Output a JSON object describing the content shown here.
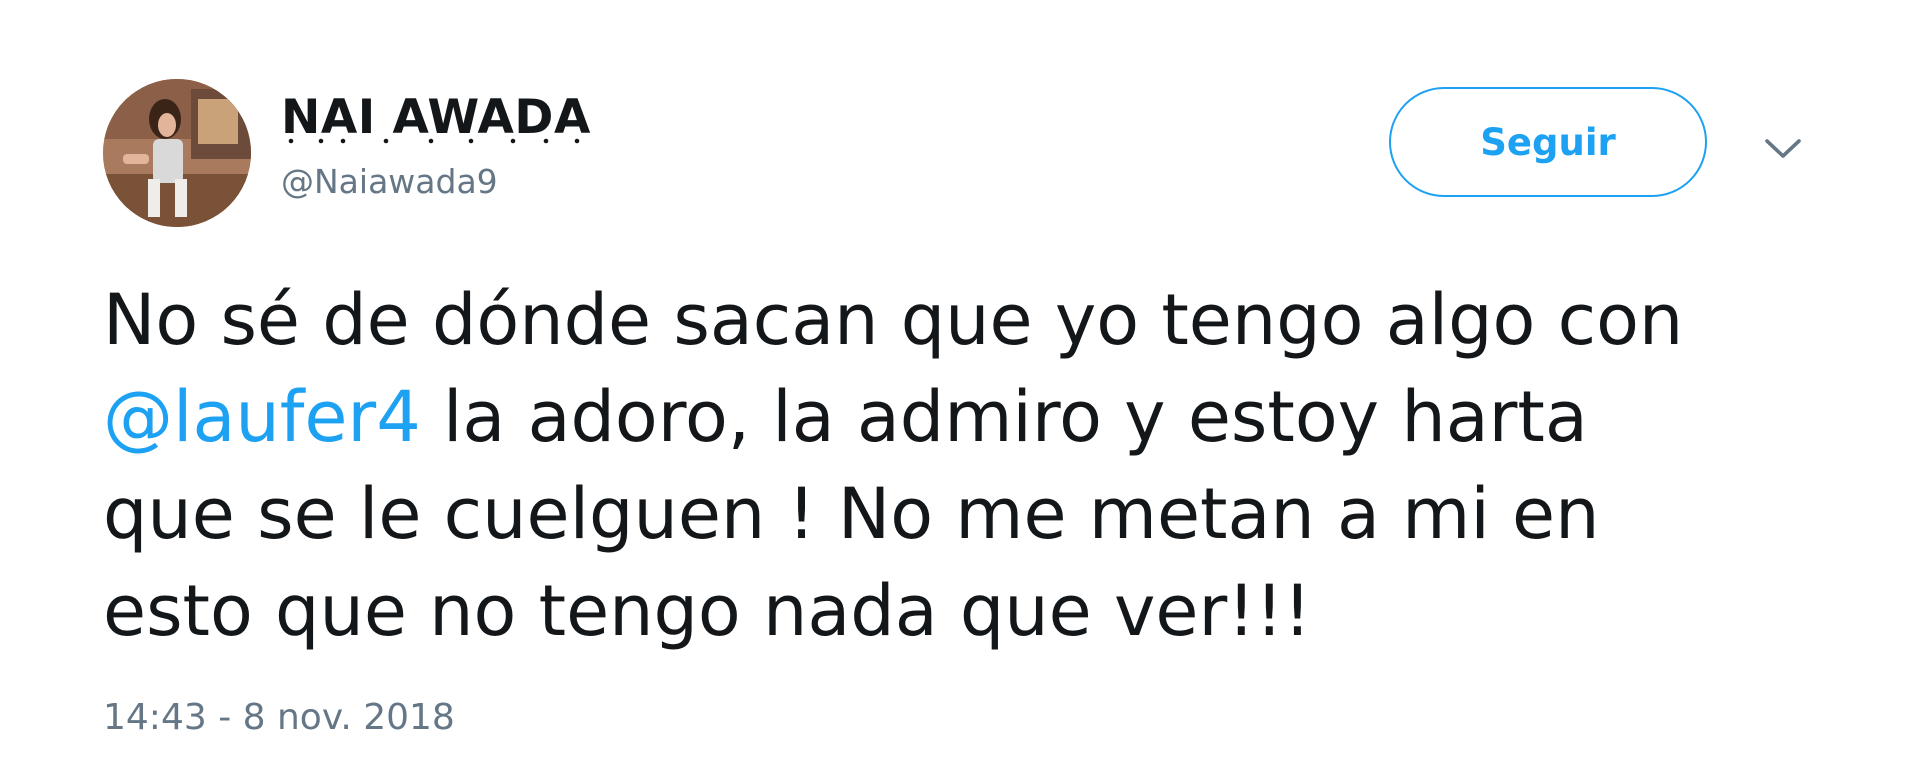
{
  "header": {
    "display_name": "NAI AWADA",
    "handle": "@Naiawada9",
    "avatar_icon": "profile-photo"
  },
  "actions": {
    "follow_label": "Seguir",
    "menu_icon": "chevron-down-icon"
  },
  "tweet": {
    "line1": "No sé de dónde sacan que yo tengo algo con",
    "mention": "@laufer4",
    "line2_rest": " la adoro, la admiro y estoy harta",
    "line3": "que se le cuelguen ! No me metan a mi en",
    "line4": "esto que no tengo nada que ver!!!",
    "timestamp": "14:43 - 8 nov. 2018"
  },
  "colors": {
    "link": "#1da1f2",
    "text": "#14171a",
    "muted": "#657786",
    "background": "#ffffff"
  }
}
